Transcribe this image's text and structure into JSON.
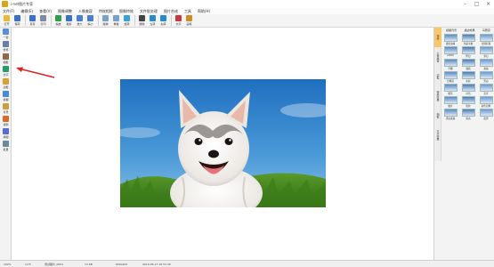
{
  "window": {
    "title": "i-net图片专家"
  },
  "menu": [
    "文件(F)",
    "编辑(E)",
    "查看(V)",
    "图像调整",
    "人像美容",
    "特效相框",
    "图像特效",
    "文件批处理",
    "图片合成",
    "工具",
    "帮助(H)"
  ],
  "toolbar": [
    {
      "label": "打开",
      "icon": "open-icon",
      "color": "#e8b936"
    },
    {
      "label": "保存",
      "icon": "save-icon",
      "color": "#3b6fc8"
    },
    {
      "label": "另存",
      "icon": "save-as-icon",
      "color": "#3b6fc8"
    },
    {
      "label": "打印",
      "icon": "print-icon",
      "color": "#7d8aa0"
    },
    {
      "label": "缩放",
      "icon": "resize-icon",
      "color": "#2e9e4f"
    },
    {
      "label": "裁剪",
      "icon": "crop-icon",
      "color": "#3b6fc8"
    },
    {
      "label": "放大",
      "icon": "zoom-in-icon",
      "color": "#4a7fd0"
    },
    {
      "label": "缩小",
      "icon": "zoom-out-icon",
      "color": "#4a7fd0"
    },
    {
      "label": "撤销",
      "icon": "undo-icon",
      "color": "#7aa0c8"
    },
    {
      "label": "重做",
      "icon": "redo-icon",
      "color": "#7aa0c8"
    },
    {
      "label": "旋转",
      "icon": "rotate-icon",
      "color": "#3aa0d8"
    },
    {
      "label": "删除",
      "icon": "delete-icon",
      "color": "#444444"
    },
    {
      "label": "左转",
      "icon": "rotate-left-icon",
      "color": "#2a8ad0"
    },
    {
      "label": "右转",
      "icon": "rotate-right-icon",
      "color": "#2a8ad0"
    },
    {
      "label": "文字",
      "icon": "text-icon",
      "color": "#c63b3b"
    },
    {
      "label": "画笔",
      "icon": "brush-icon",
      "color": "#d08a2a"
    }
  ],
  "left_tools": [
    {
      "label": "一键",
      "icon": "auto-icon",
      "color": "#5a8fd8"
    },
    {
      "label": "修饰",
      "icon": "retouch-icon",
      "color": "#6a7fa8"
    },
    {
      "label": "相框",
      "icon": "frame-icon",
      "color": "#8a6a4a"
    },
    {
      "label": "文字",
      "icon": "text-tool-icon",
      "color": "#2a9a6a"
    },
    {
      "label": "边框",
      "icon": "border-icon",
      "color": "#d8a030"
    },
    {
      "label": "模糊",
      "icon": "blur-icon",
      "color": "#4a8ad8"
    },
    {
      "label": "背景",
      "icon": "background-icon",
      "color": "#c8a040"
    },
    {
      "label": "涂鸦",
      "icon": "doodle-icon",
      "color": "#d86a2a"
    },
    {
      "label": "拼图",
      "icon": "collage-icon",
      "color": "#5a6ad8"
    },
    {
      "label": "批量",
      "icon": "batch-icon",
      "color": "#6a8a9a"
    }
  ],
  "right_panel": {
    "headers": [
      "模糊背景",
      "描边效果",
      "马赛克"
    ],
    "tabs": [
      "特效",
      "人像美容",
      "边框",
      "特殊效果",
      "相框",
      "艺术效果"
    ],
    "effects": [
      "柔化边缘",
      "色彩平衡",
      "去除红眼",
      "LOMO",
      "怀旧",
      "梦幻",
      "浮雕",
      "油画",
      "素描",
      "铅笔画",
      "水彩",
      "黑白",
      "暖色",
      "冷色",
      "高光",
      "胶片",
      "锐化",
      "彩色铅笔",
      "黑白素描",
      "复古",
      "夜景"
    ]
  },
  "status": {
    "zoom": "100%",
    "index": "1/75",
    "filename": "测试图片_0001",
    "filesize": "13 KB",
    "dimensions": "600x400",
    "datetime": "2019-05-17 10:51:45"
  }
}
